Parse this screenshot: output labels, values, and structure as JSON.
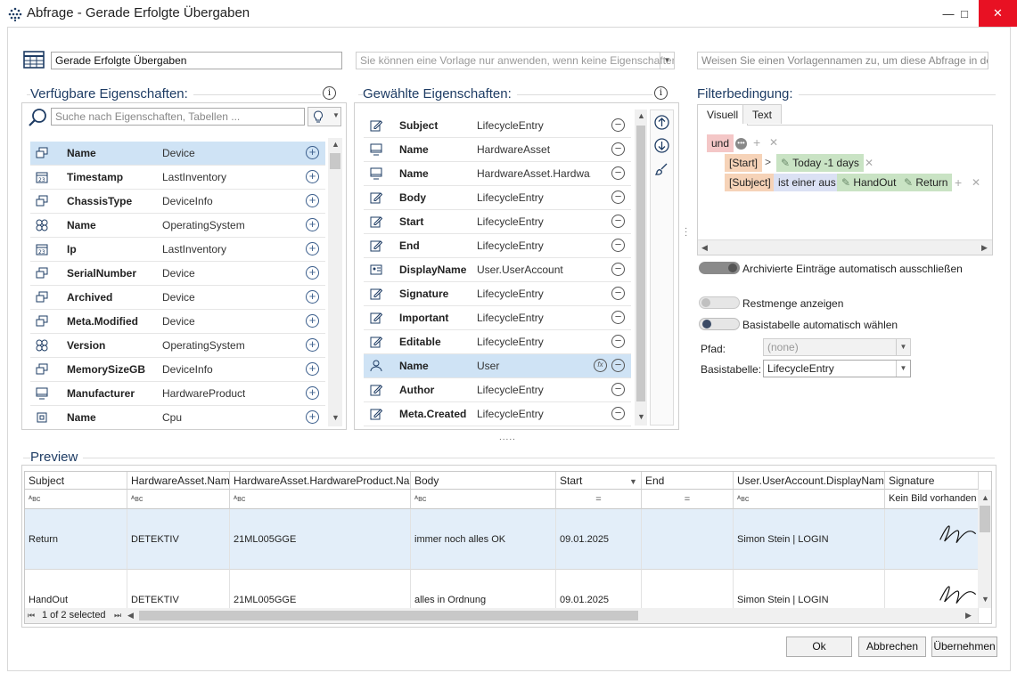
{
  "window": {
    "title": "Abfrage - Gerade Erfolgte Übergaben",
    "minimize": "—",
    "maximize": "□",
    "close": "✕"
  },
  "top": {
    "query_name": "Gerade Erfolgte Übergaben",
    "template_select": "Sie können eine Vorlage nur anwenden, wenn keine Eigenschaften ...",
    "template_name_placeholder": "Weisen Sie einen Vorlagennamen zu, um diese Abfrage in der Vorla"
  },
  "available": {
    "title": "Verfügbare Eigenschaften:",
    "search_placeholder": "Suche nach Eigenschaften, Tabellen ...",
    "items": [
      {
        "name": "Name",
        "type": "Device",
        "icon": "device-icon",
        "selected": true
      },
      {
        "name": "Timestamp",
        "type": "LastInventory",
        "icon": "calendar-icon"
      },
      {
        "name": "ChassisType",
        "type": "DeviceInfo",
        "icon": "device-icon"
      },
      {
        "name": "Name",
        "type": "OperatingSystem",
        "icon": "os-icon"
      },
      {
        "name": "Ip",
        "type": "LastInventory",
        "icon": "calendar-icon"
      },
      {
        "name": "SerialNumber",
        "type": "Device",
        "icon": "device-icon"
      },
      {
        "name": "Archived",
        "type": "Device",
        "icon": "device-icon"
      },
      {
        "name": "Meta.Modified",
        "type": "Device",
        "icon": "device-icon"
      },
      {
        "name": "Version",
        "type": "OperatingSystem",
        "icon": "os-icon"
      },
      {
        "name": "MemorySizeGB",
        "type": "DeviceInfo",
        "icon": "device-icon"
      },
      {
        "name": "Manufacturer",
        "type": "HardwareProduct",
        "icon": "monitor-icon"
      },
      {
        "name": "Name",
        "type": "Cpu",
        "icon": "cpu-icon"
      }
    ]
  },
  "chosen": {
    "title": "Gewählte Eigenschaften:",
    "items": [
      {
        "name": "Subject",
        "type": "LifecycleEntry",
        "icon": "edit-icon"
      },
      {
        "name": "Name",
        "type": "HardwareAsset",
        "icon": "monitor-icon"
      },
      {
        "name": "Name",
        "type": "HardwareAsset.Hardwa...",
        "icon": "monitor-icon"
      },
      {
        "name": "Body",
        "type": "LifecycleEntry",
        "icon": "edit-icon"
      },
      {
        "name": "Start",
        "type": "LifecycleEntry",
        "icon": "edit-icon"
      },
      {
        "name": "End",
        "type": "LifecycleEntry",
        "icon": "edit-icon"
      },
      {
        "name": "DisplayName",
        "type": "User.UserAccount",
        "icon": "id-card-icon"
      },
      {
        "name": "Signature",
        "type": "LifecycleEntry",
        "icon": "edit-icon"
      },
      {
        "name": "Important",
        "type": "LifecycleEntry",
        "icon": "edit-icon"
      },
      {
        "name": "Editable",
        "type": "LifecycleEntry",
        "icon": "edit-icon"
      },
      {
        "name": "Name",
        "type": "User",
        "icon": "user-icon",
        "selected": true
      },
      {
        "name": "Author",
        "type": "LifecycleEntry",
        "icon": "edit-icon"
      },
      {
        "name": "Meta.Created",
        "type": "LifecycleEntry",
        "icon": "edit-icon"
      }
    ]
  },
  "filter": {
    "title": "Filterbedingung:",
    "tab_visual": "Visuell",
    "tab_text": "Text",
    "op_and": "und",
    "chip_start": "[Start]",
    "gt": ">",
    "chip_today": "Today -1 days",
    "chip_subject": "[Subject]",
    "chip_oneof": "ist einer aus",
    "chip_handout": "HandOut",
    "chip_return": "Return",
    "archived_label": "Archivierte Einträge automatisch ausschließen",
    "rest_label": "Restmenge anzeigen",
    "basetable_auto_label": "Basistabelle automatisch wählen",
    "path_label": "Pfad:",
    "path_value": "(none)",
    "basetable_label": "Basistabelle:",
    "basetable_value": "LifecycleEntry"
  },
  "preview": {
    "title": "Preview",
    "columns": [
      "Subject",
      "HardwareAsset.Name",
      "HardwareAsset.HardwareProduct.Name",
      "Body",
      "Start",
      "End",
      "User.UserAccount.DisplayName",
      "Signature"
    ],
    "filters": [
      "ᴬʙᴄ",
      "ᴬʙᴄ",
      "ᴬʙᴄ",
      "ᴬʙᴄ",
      "=",
      "=",
      "ᴬʙᴄ",
      "Kein Bild vorhanden"
    ],
    "rows": [
      [
        "Return",
        "DETEKTIV",
        "21ML005GGE",
        "immer noch alles OK",
        "09.01.2025",
        "",
        "Simon Stein | LOGIN",
        ""
      ],
      [
        "HandOut",
        "DETEKTIV",
        "21ML005GGE",
        "alles in Ordnung",
        "09.01.2025",
        "",
        "Simon Stein | LOGIN",
        ""
      ]
    ],
    "status": "1 of 2 selected"
  },
  "buttons": {
    "ok": "Ok",
    "cancel": "Abbrechen",
    "apply": "Übernehmen"
  },
  "colors": {
    "accent": "#1e3c64",
    "selected_row": "#cfe3f5",
    "chip_and": "#f4c7c7",
    "chip_field": "#f6d3b8",
    "chip_value": "#c9e3c4",
    "chip_op": "#dbe1f4"
  }
}
